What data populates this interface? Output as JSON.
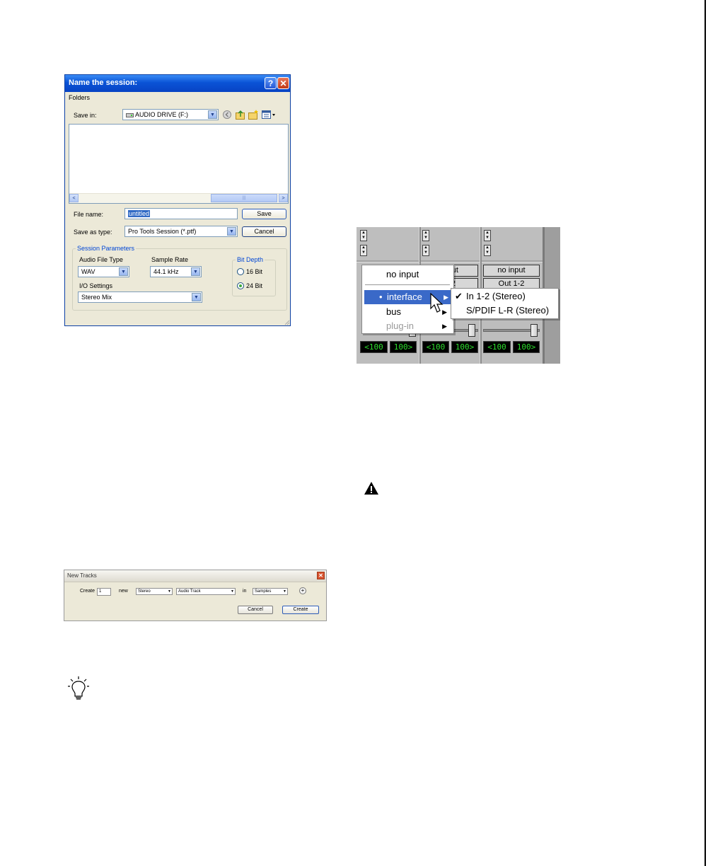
{
  "save_dialog": {
    "title": "Name the session:",
    "help_glyph": "?",
    "close_glyph": "✕",
    "folders_label": "Folders",
    "save_in_label": "Save in:",
    "save_in_value": "AUDIO DRIVE (F:)",
    "scroll_left": "<",
    "scroll_right": ">",
    "scroll_grip": "|||",
    "file_name_label": "File name:",
    "file_name_value": "untitled",
    "save_as_type_label": "Save as type:",
    "save_as_type_value": "Pro Tools Session (*.ptf)",
    "save_button": "Save",
    "cancel_button": "Cancel",
    "session_params_label": "Session Parameters",
    "audio_file_type_label": "Audio File Type",
    "audio_file_type_value": "WAV",
    "sample_rate_label": "Sample Rate",
    "sample_rate_value": "44.1 kHz",
    "io_settings_label": "I/O Settings",
    "io_settings_value": "Stereo Mix",
    "bit_depth_label": "Bit Depth",
    "bit_16_label": "16 Bit",
    "bit_24_label": "24 Bit",
    "bit_depth_selected": "24 Bit"
  },
  "new_tracks_dialog": {
    "title": "New Tracks",
    "close_glyph": "✕",
    "create_label": "Create",
    "count_value": "1",
    "new_label": "new",
    "format_value": "Stereo",
    "track_type_value": "Audio Track",
    "in_label": "in",
    "timebase_value": "Samples",
    "add_row_glyph": "+",
    "cancel_button": "Cancel",
    "create_button": "Create"
  },
  "mixer": {
    "strip_2_input": "input",
    "strip_2_output": "1-2",
    "strip_3_input": "no input",
    "strip_3_output": "Out 1-2",
    "pan_left": "<100",
    "pan_right": "100>",
    "input_menu": {
      "no_input": "no input",
      "interface": "interface",
      "bus": "bus",
      "plug_in": "plug-in",
      "selected_marker": "•",
      "submenu_arrow": "▶"
    },
    "interface_submenu": {
      "in_1_2": "In 1-2 (Stereo)",
      "spdif": "S/PDIF L-R (Stereo)",
      "checked": "In 1-2 (Stereo)",
      "check_glyph": "✔"
    }
  },
  "icons": {
    "warning": "warning-icon",
    "tip": "lightbulb-icon"
  },
  "colors": {
    "xp_title_blue": "#0a53d6",
    "menu_highlight": "#3a69c8",
    "pan_green": "#2dde2d"
  }
}
